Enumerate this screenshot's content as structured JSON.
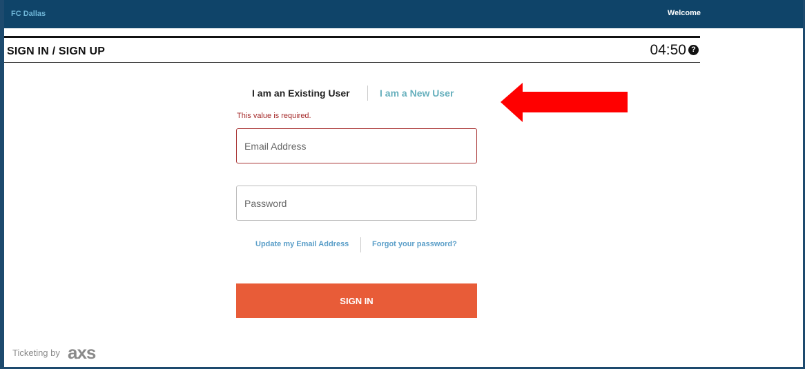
{
  "topbar": {
    "brand": "FC Dallas",
    "welcome": "Welcome"
  },
  "header": {
    "title": "SIGN IN / SIGN UP",
    "timer": "04:50",
    "help_icon": "question-circle-icon"
  },
  "tabs": {
    "existing": "I am an Existing User",
    "new": "I am a New User"
  },
  "form": {
    "error": "This value is required.",
    "email_placeholder": "Email Address",
    "password_placeholder": "Password",
    "update_email": "Update my Email Address",
    "forgot_password": "Forgot your password?",
    "submit": "SIGN IN"
  },
  "footer": {
    "ticketing": "Ticketing by",
    "logo": "axs"
  },
  "annotation": {
    "icon": "red-arrow-icon",
    "color": "#ff0000"
  },
  "colors": {
    "topbar": "#0f4469",
    "accent": "#e85c38",
    "link": "#5a9ec8",
    "error": "#a52a2a"
  }
}
